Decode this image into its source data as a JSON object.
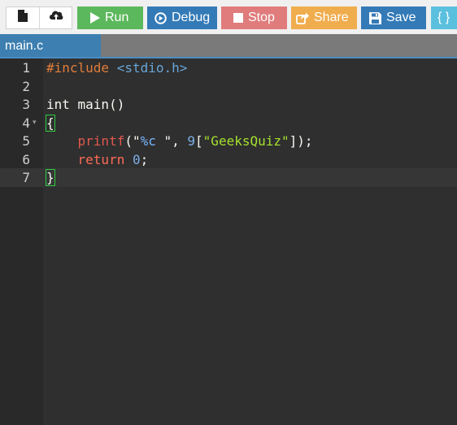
{
  "toolbar": {
    "buttons": {
      "run": "Run",
      "debug": "Debug",
      "stop": "Stop",
      "share": "Share",
      "save": "Save",
      "beautify": "{ }"
    },
    "colors": {
      "run": "#5cb85c",
      "debug": "#337ab7",
      "stop": "#e07c7c",
      "share": "#f0ad4e",
      "save": "#337ab7",
      "beautify": "#5bc0de"
    },
    "icons": {
      "new_file": "new-file-icon",
      "upload": "upload-cloud-icon"
    }
  },
  "tabs": [
    {
      "label": "main.c",
      "active": true
    }
  ],
  "editor": {
    "line_numbers": [
      "1",
      "2",
      "3",
      "4",
      "5",
      "6",
      "7"
    ],
    "active_line": 7,
    "code": {
      "l1": {
        "directive": "#include",
        "space": " ",
        "header": "<stdio.h>"
      },
      "l3": {
        "text": "int main()"
      },
      "l4": {
        "open": "{"
      },
      "l5": {
        "indent": "    ",
        "fn": "printf",
        "p1": "(\"",
        "fmt": "%c",
        "p2": " \"",
        "p3": ", ",
        "num": "9",
        "p4": "[",
        "str": "\"GeeksQuiz\"",
        "p5": "]);"
      },
      "l6": {
        "indent": "    ",
        "kw": "return",
        "space": " ",
        "num": "0",
        "semi": ";"
      },
      "l7": {
        "close": "}"
      }
    }
  }
}
